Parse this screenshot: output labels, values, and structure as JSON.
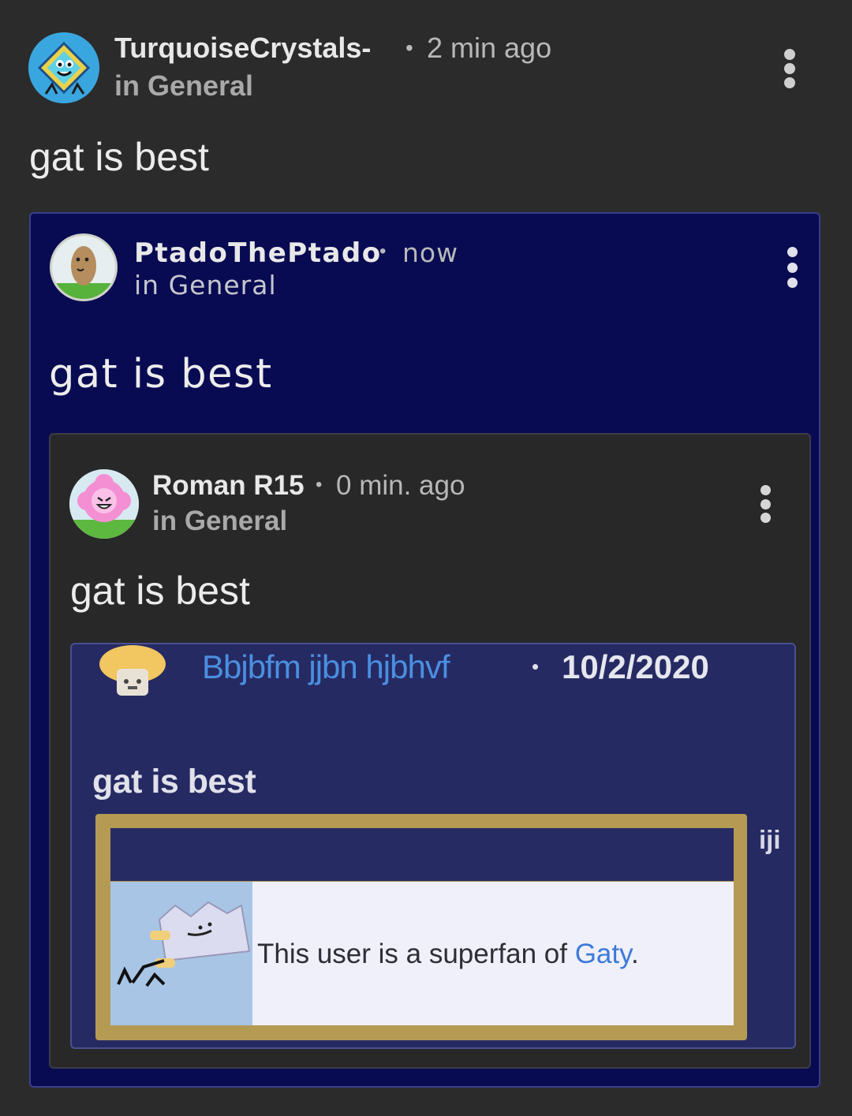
{
  "post": {
    "author": "TurquoiseCrystals-",
    "time": "2 min ago",
    "channel": "in General",
    "body": "gat is best",
    "avatar": "diamond-character-avatar-icon"
  },
  "quote1": {
    "author": "PtadoThePtado",
    "time": "now",
    "channel": "in General",
    "body": "gat is best",
    "avatar": "potato-character-avatar-icon"
  },
  "quote2": {
    "author": "Roman R15",
    "time": "0 min. ago",
    "channel": "in General",
    "body": "gat is best",
    "avatar": "pink-flower-character-avatar-icon"
  },
  "quote3": {
    "author": "Bbjbfm jjbn hjbhvf",
    "time": "10/2/2020",
    "body": "gat is best",
    "avatar": "blond-cube-avatar-icon",
    "author_color": "#4a8fe0"
  },
  "userbox": {
    "text_prefix": "This user is a superfan of ",
    "link_text": "Gaty",
    "text_suffix": ".",
    "side_label": "iji",
    "image": "gaty-character-icon"
  },
  "dot": "•",
  "colors": {
    "background": "#2b2b2c",
    "quote1_bg": "#080b52",
    "quote3_bg": "#262a63",
    "userbox_border": "#b59a54"
  }
}
